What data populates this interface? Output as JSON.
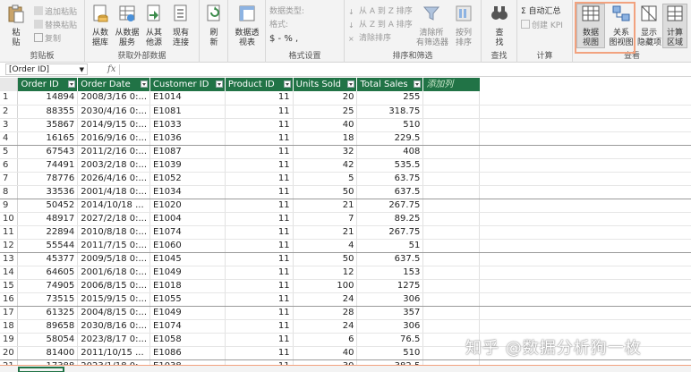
{
  "ribbon": {
    "clipboard": {
      "paste": "粘\n贴",
      "append_paste": "追加粘贴",
      "replace_paste": "替换粘贴",
      "copy": "复制",
      "label": "剪贴板"
    },
    "external": {
      "from_db": "从数\n据库",
      "from_service": "从数据\n服务",
      "from_other": "从其\n他源",
      "existing": "现有\n连接",
      "label": "获取外部数据"
    },
    "refresh": "刷\n新",
    "pivot": "数据透\n视表",
    "format": {
      "data_type": "数据类型:",
      "format": "格式:",
      "symbols": "$ - % ,",
      "label": "格式设置"
    },
    "sort": {
      "asc": "从 A 到 Z 排序",
      "desc": "从 Z 到 A 排序",
      "clear_sort": "清除排序",
      "clear_filters": "清除所\n有筛选器",
      "sort_by_column": "按列\n排序",
      "label": "排序和筛选"
    },
    "find": {
      "btn": "查\n找",
      "label": "查找"
    },
    "calc": {
      "autosum": "Σ 自动汇总",
      "kpi": "创建 KPI",
      "label": "计算"
    },
    "view": {
      "data_view": "数据\n视图",
      "diagram_view": "关系\n图视图",
      "show_hidden": "显示\n隐藏项",
      "calc_area": "计算\n区域",
      "label": "查看"
    }
  },
  "formula_bar": {
    "name_box": "[Order ID]",
    "fx": "fx"
  },
  "table": {
    "columns": [
      "Order ID",
      "Order Date",
      "Customer ID",
      "Product ID",
      "Units Sold",
      "Total Sales"
    ],
    "add_column": "添加列",
    "rows": [
      [
        "1",
        "14894",
        "2008/3/16 0:...",
        "E1014",
        "11",
        "20",
        "255"
      ],
      [
        "2",
        "88355",
        "2030/4/16 0:...",
        "E1081",
        "11",
        "25",
        "318.75"
      ],
      [
        "3",
        "35867",
        "2014/9/15 0:...",
        "E1033",
        "11",
        "40",
        "510"
      ],
      [
        "4",
        "16165",
        "2016/9/16 0:...",
        "E1036",
        "11",
        "18",
        "229.5"
      ],
      [
        "5",
        "67543",
        "2011/2/16 0:...",
        "E1087",
        "11",
        "32",
        "408"
      ],
      [
        "6",
        "74491",
        "2003/2/18 0:...",
        "E1039",
        "11",
        "42",
        "535.5"
      ],
      [
        "7",
        "78776",
        "2026/4/16 0:...",
        "E1052",
        "11",
        "5",
        "63.75"
      ],
      [
        "8",
        "33536",
        "2001/4/18 0:...",
        "E1034",
        "11",
        "50",
        "637.5"
      ],
      [
        "9",
        "50452",
        "2014/10/18 ...",
        "E1020",
        "11",
        "21",
        "267.75"
      ],
      [
        "10",
        "48917",
        "2027/2/18 0:...",
        "E1004",
        "11",
        "7",
        "89.25"
      ],
      [
        "11",
        "22894",
        "2010/8/18 0:...",
        "E1074",
        "11",
        "21",
        "267.75"
      ],
      [
        "12",
        "55544",
        "2011/7/15 0:...",
        "E1060",
        "11",
        "4",
        "51"
      ],
      [
        "13",
        "45377",
        "2009/5/18 0:...",
        "E1045",
        "11",
        "50",
        "637.5"
      ],
      [
        "14",
        "64605",
        "2001/6/18 0:...",
        "E1049",
        "11",
        "12",
        "153"
      ],
      [
        "15",
        "74905",
        "2006/8/15 0:...",
        "E1018",
        "11",
        "100",
        "1275"
      ],
      [
        "16",
        "73515",
        "2015/9/15 0:...",
        "E1055",
        "11",
        "24",
        "306"
      ],
      [
        "17",
        "61325",
        "2004/8/15 0:...",
        "E1049",
        "11",
        "28",
        "357"
      ],
      [
        "18",
        "89658",
        "2030/8/16 0:...",
        "E1074",
        "11",
        "24",
        "306"
      ],
      [
        "19",
        "58054",
        "2023/8/17 0:...",
        "E1058",
        "11",
        "6",
        "76.5"
      ],
      [
        "20",
        "81400",
        "2011/10/15 ...",
        "E1086",
        "11",
        "40",
        "510"
      ],
      [
        "21",
        "17388",
        "2023/1/18 0:...",
        "E1038",
        "11",
        "30",
        "382.5"
      ]
    ]
  },
  "watermark": "知乎 @数据分析狗一枚",
  "colors": {
    "header_green": "#217346",
    "highlight": "#f2a27f"
  }
}
